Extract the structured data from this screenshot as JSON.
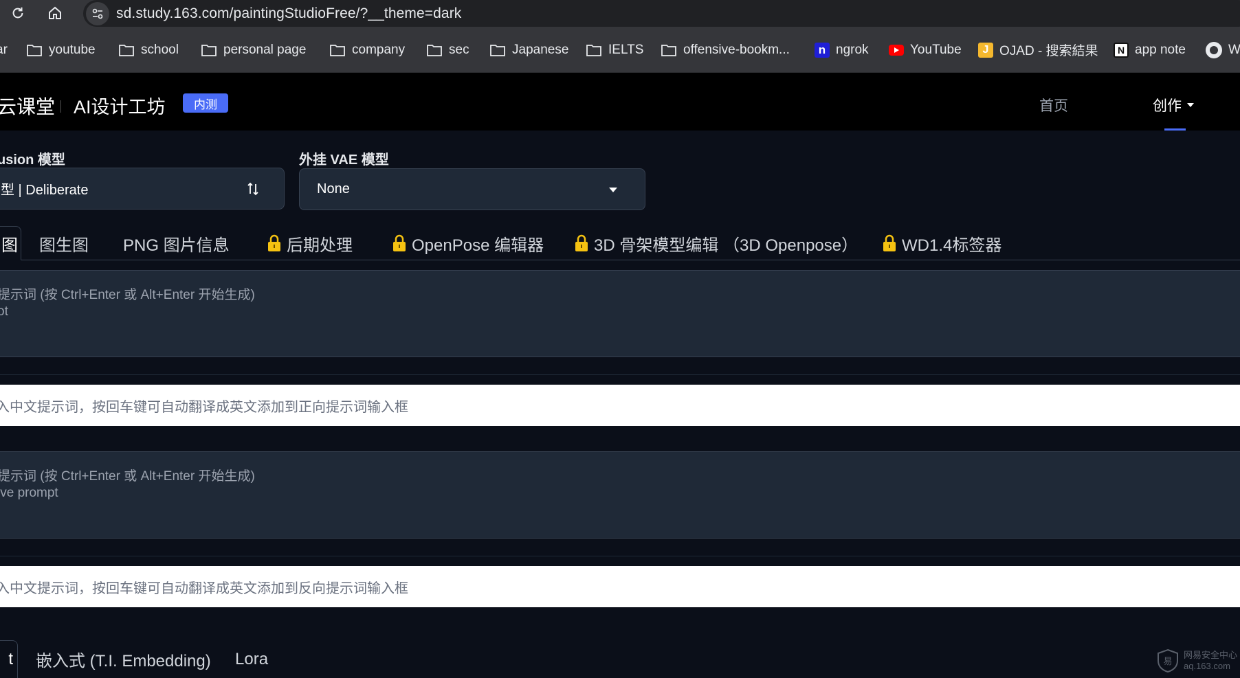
{
  "browser": {
    "url": "sd.study.163.com/paintingStudioFree/?__theme=dark",
    "bookmarks": [
      {
        "label": "ar",
        "icon": "folder-icon"
      },
      {
        "label": "youtube",
        "icon": "folder-icon"
      },
      {
        "label": "school",
        "icon": "folder-icon"
      },
      {
        "label": "personal page",
        "icon": "folder-icon"
      },
      {
        "label": "company",
        "icon": "folder-icon"
      },
      {
        "label": "sec",
        "icon": "folder-icon"
      },
      {
        "label": "Japanese",
        "icon": "folder-icon"
      },
      {
        "label": "IELTS",
        "icon": "folder-icon"
      },
      {
        "label": "offensive-bookm...",
        "icon": "folder-icon"
      },
      {
        "label": "ngrok",
        "icon": "ngrok-icon"
      },
      {
        "label": "YouTube",
        "icon": "youtube-icon"
      },
      {
        "label": "OJAD - 搜索結果",
        "icon": "ojad-icon"
      },
      {
        "label": "app note",
        "icon": "notion-icon"
      },
      {
        "label": "W",
        "icon": "globe-icon"
      }
    ]
  },
  "header": {
    "brand": "云课堂",
    "subtitle": "AI设计工坊",
    "beta_badge": "内测",
    "nav_home": "首页",
    "nav_create": "创作"
  },
  "models": {
    "sd_label": "usion 模型",
    "sd_value": "型 | Deliberate",
    "vae_label": "外挂 VAE 模型",
    "vae_value": "None"
  },
  "tabs": {
    "active": "图",
    "items": [
      "图生图",
      "PNG 图片信息",
      "后期处理",
      "OpenPose 编辑器",
      "3D 骨架模型编辑 （3D Openpose）",
      "WD1.4标签器"
    ],
    "locked": [
      false,
      false,
      true,
      true,
      true,
      true
    ]
  },
  "prompts": {
    "positive_placeholder_line1": "提示词 (按 Ctrl+Enter 或 Alt+Enter 开始生成)",
    "positive_placeholder_line2": "ot",
    "positive_translate_placeholder": "入中文提示词，按回车键可自动翻译成英文添加到正向提示词输入框",
    "negative_placeholder_line1": "提示词 (按 Ctrl+Enter 或 Alt+Enter 开始生成)",
    "negative_placeholder_line2": "ive prompt",
    "negative_translate_placeholder": "入中文提示词，按回车键可自动翻译成英文添加到反向提示词输入框"
  },
  "lower_tabs": {
    "active": "t",
    "items": [
      "嵌入式 (T.I. Embedding)",
      "Lora"
    ]
  },
  "watermark": {
    "line1": "网易安全中心",
    "line2": "aq.163.com"
  },
  "colors": {
    "accent": "#4a6cf7",
    "background": "#0b0f19",
    "panel": "#1f2937",
    "lock": "#f5c211",
    "youtube_red": "#ff0000",
    "ngrok_blue": "#1f1fd6",
    "ojad_yellow": "#f5b82e"
  }
}
